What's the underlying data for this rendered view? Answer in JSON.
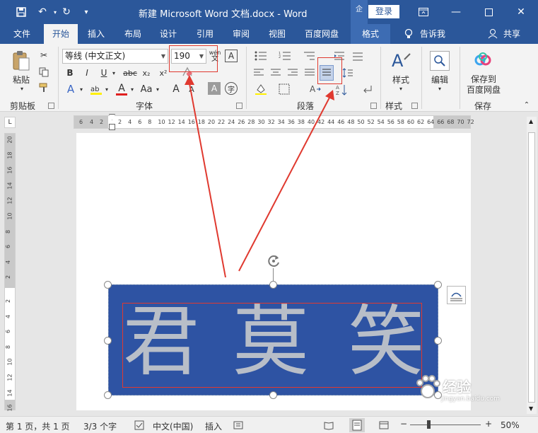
{
  "window": {
    "title": "新建 Microsoft Word 文档.docx  -  Word",
    "share_badge": "企",
    "login_label": "登录"
  },
  "tabs": [
    {
      "label": "文件"
    },
    {
      "label": "开始"
    },
    {
      "label": "插入"
    },
    {
      "label": "布局"
    },
    {
      "label": "设计"
    },
    {
      "label": "引用"
    },
    {
      "label": "审阅"
    },
    {
      "label": "视图"
    },
    {
      "label": "百度网盘"
    },
    {
      "label": "格式"
    }
  ],
  "tell_me": "告诉我",
  "share": "共享",
  "ribbon": {
    "clipboard": {
      "label": "剪贴板",
      "paste": "粘贴"
    },
    "font": {
      "label": "字体",
      "font_name": "等线 (中文正文)",
      "font_size": "190",
      "wen": "wén",
      "bold": "B",
      "italic": "I",
      "underline": "U",
      "strike": "abc",
      "subscript": "x₂",
      "superscript": "x²",
      "font_color_letter": "A",
      "aa": "Aa",
      "grow": "A",
      "shrink": "A",
      "char_shade": "A",
      "enclose": "字"
    },
    "paragraph": {
      "label": "段落"
    },
    "styles": {
      "label": "样式",
      "button": "样式"
    },
    "editing": {
      "button": "编辑"
    },
    "save": {
      "label": "保存",
      "button_line1": "保存到",
      "button_line2": "百度网盘"
    }
  },
  "ruler": {
    "h_left": [
      "6",
      "4",
      "2"
    ],
    "h_right": [
      "2",
      "4",
      "6",
      "8",
      "10",
      "12",
      "14",
      "16",
      "18",
      "20",
      "22",
      "24",
      "26",
      "28",
      "30",
      "32",
      "34",
      "36",
      "38",
      "40",
      "42",
      "44",
      "46",
      "48",
      "50",
      "52",
      "54",
      "56",
      "58",
      "60",
      "62",
      "64",
      "66",
      "68",
      "70",
      "72"
    ],
    "v_top": [
      "20",
      "18",
      "16",
      "14",
      "12",
      "10",
      "8",
      "6",
      "4",
      "2"
    ],
    "v_bottom": [
      "2",
      "4",
      "6",
      "8",
      "10",
      "12",
      "14",
      "16"
    ]
  },
  "textbox": {
    "chars": [
      "君",
      "莫",
      "笑"
    ]
  },
  "status": {
    "page": "第 1 页，共 1 页",
    "words": "3/3 个字",
    "lang": "中文(中国)",
    "mode": "插入",
    "zoom": "50%"
  },
  "watermark": {
    "line1": "经验",
    "line2": "jingyan.baidu.com"
  },
  "colors": {
    "accent": "#2b579a",
    "highlight": "#e0392f",
    "textbox_fill": "#2e53a3",
    "text_fill": "#b8bec8"
  }
}
